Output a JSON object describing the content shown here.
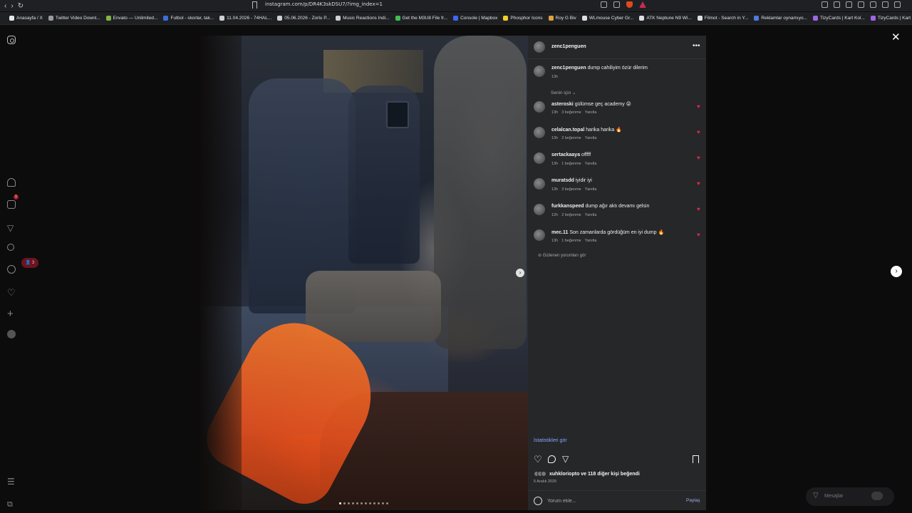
{
  "browser": {
    "url": "instagram.com/p/DR4K3skDSU7/?img_index=1",
    "bookmarks": [
      {
        "label": "Anasayfa / X",
        "color": "#e7e7e7"
      },
      {
        "label": "Twitter Video Downl...",
        "color": "#9a9a9a"
      },
      {
        "label": "Envato — Unlimited...",
        "color": "#82b541"
      },
      {
        "label": "Futbol - skorlar, tak...",
        "color": "#3a6fd8"
      },
      {
        "label": "11.04.2026 - 74HAL...",
        "color": "#cfcfcf"
      },
      {
        "label": "05.06.2026 - Zorlu P...",
        "color": "#cfcfcf"
      },
      {
        "label": "Music Reactions Indi...",
        "color": "#d0d0d0"
      },
      {
        "label": "Get the M3U8 File fr...",
        "color": "#3fbf4f"
      },
      {
        "label": "Console | Mapbox",
        "color": "#4264fb"
      },
      {
        "label": "Phosphor Icons",
        "color": "#f2d024"
      },
      {
        "label": "Roy G Biv",
        "color": "#e0a33a"
      },
      {
        "label": "WLmouse Cyber Gr...",
        "color": "#dedede"
      },
      {
        "label": "ATK Neptune N9 Wi...",
        "color": "#dedede"
      },
      {
        "label": "Filmot - Search in Y...",
        "color": "#dedede"
      },
      {
        "label": "Reklamlar oynamıyo...",
        "color": "#4f7ae0"
      },
      {
        "label": "TizyCards | Kart Kol...",
        "color": "#a065e6"
      },
      {
        "label": "TizyCards | Kart Kol...",
        "color": "#a065e6"
      }
    ]
  },
  "sidebar": {
    "notification_count": "1",
    "activity_count": "3"
  },
  "post": {
    "username": "zenc1penguen",
    "caption_user": "zenc1penguen",
    "caption_text": "dump cahiliyim özür dilerim",
    "caption_time": "13h",
    "section_label": "Senin için",
    "comments": [
      {
        "user": "asteroski",
        "text": "gülümse geç academy 😝",
        "time": "13h",
        "likes": "3 beğenme",
        "reply": "Yanıtla"
      },
      {
        "user": "celalcan.topal",
        "text": "harika harika 🔥",
        "time": "13h",
        "likes": "2 beğenme",
        "reply": "Yanıtla"
      },
      {
        "user": "sertackaaya",
        "text": "offfff",
        "time": "13h",
        "likes": "1 beğenme",
        "reply": "Yanıtla"
      },
      {
        "user": "muratsdd",
        "text": "iyidir iyi",
        "time": "13h",
        "likes": "3 beğenme",
        "reply": "Yanıtla"
      },
      {
        "user": "furkkanspeed",
        "text": "dump ağır aktı devamı gelsin",
        "time": "12h",
        "likes": "2 beğenme",
        "reply": "Yanıtla"
      },
      {
        "user": "mec.11",
        "text": "Son zamanlarda gördüğüm en iyi dump 🔥",
        "time": "13h",
        "likes": "1 beğenme",
        "reply": "Yanıtla"
      }
    ],
    "hidden_comments": "Gizlenen yorumları gör",
    "stats_link": "İstatistikleri gör",
    "liked_by": "xuhkloriopto ve 118 diğer kişi beğendi",
    "date": "5 Aralık 2025",
    "comment_placeholder": "Yorum ekle...",
    "share_label": "Paylaş",
    "carousel_count": 12,
    "carousel_active": 1
  },
  "messages": {
    "label": "Mesajlar"
  },
  "colors": {
    "like_red": "#e8283f",
    "link_blue": "#8aa4ff",
    "panel_bg": "#262729"
  }
}
